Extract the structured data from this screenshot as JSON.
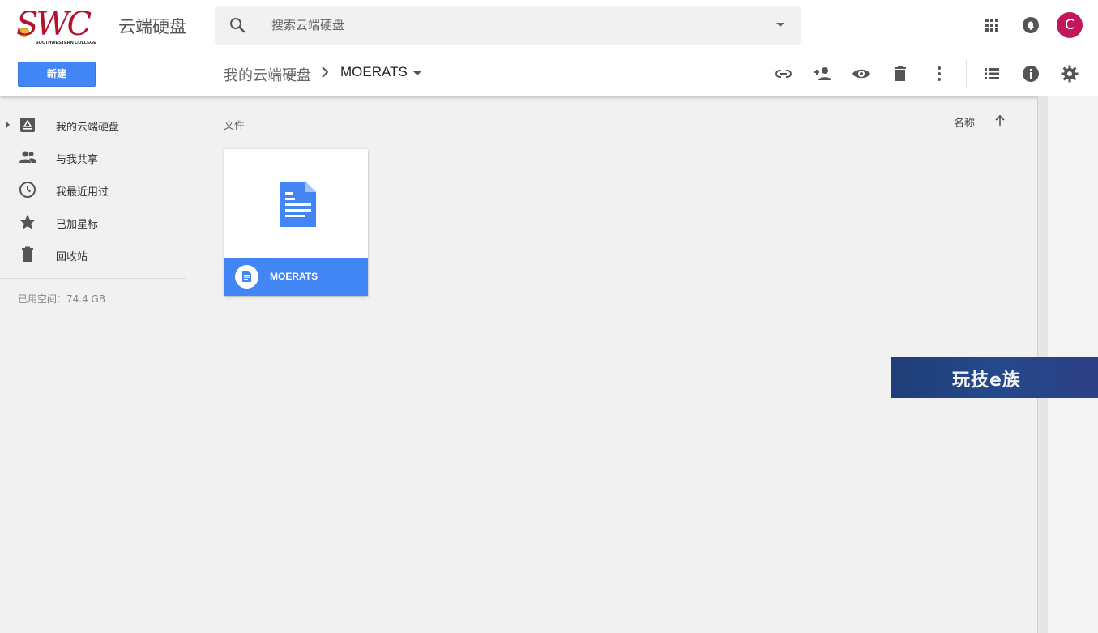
{
  "header": {
    "logo_text": "SWC",
    "logo_subtitle": "SOUTHWESTERN COLLEGE",
    "product_name": "云端硬盘",
    "search_placeholder": "搜索云端硬盘",
    "avatar_letter": "C",
    "avatar_color": "#c2185b",
    "icons": [
      "apps-icon",
      "notifications-icon"
    ]
  },
  "toolbar": {
    "new_button_label": "新建",
    "breadcrumb_root": "我的云端硬盘",
    "breadcrumb_current": "MOERATS",
    "icons": [
      "link-icon",
      "add-person-icon",
      "eye-icon",
      "trash-icon",
      "more-vertical-icon",
      "list-view-icon",
      "info-icon",
      "settings-icon"
    ],
    "accent_color": "#4285f4"
  },
  "sidebar": {
    "items": [
      {
        "label": "我的云端硬盘",
        "icon": "drive-icon"
      },
      {
        "label": "与我共享",
        "icon": "people-icon"
      },
      {
        "label": "我最近用过",
        "icon": "clock-icon"
      },
      {
        "label": "已加星标",
        "icon": "star-icon"
      },
      {
        "label": "回收站",
        "icon": "trash-icon"
      }
    ],
    "storage_text": "已用空间：74.4 GB"
  },
  "main": {
    "section_title": "文件",
    "sort_label": "名称",
    "files": [
      {
        "name": "MOERATS",
        "type": "document",
        "icon": "document-icon"
      }
    ]
  },
  "watermark": {
    "text": "玩技e族"
  }
}
